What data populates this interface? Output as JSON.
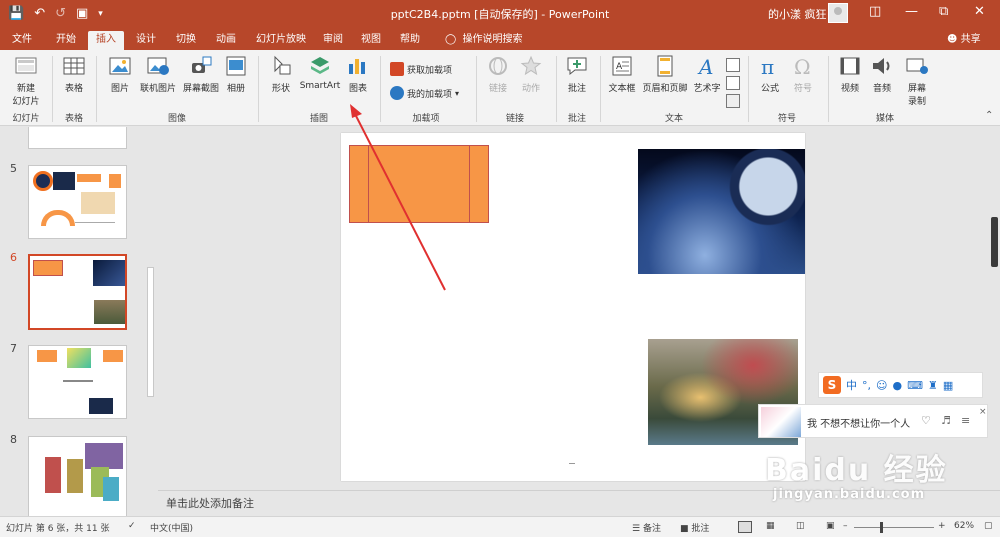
{
  "qat": {
    "save_icon": "save-icon",
    "undo_icon": "undo-icon",
    "redo_icon": "redo-icon",
    "present_icon": "present-icon",
    "more_icon": "chevron-down-icon"
  },
  "window": {
    "title": "pptC2B4.pptm [自动保存的] - PowerPoint",
    "user": "的小漾 疯狂"
  },
  "tabs": [
    "文件",
    "开始",
    "插入",
    "设计",
    "切换",
    "动画",
    "幻灯片放映",
    "审阅",
    "视图",
    "帮助"
  ],
  "active_tab": "插入",
  "tell_me": "操作说明搜索",
  "share": "共享",
  "ribbon": {
    "new_slide": "新建\n幻灯片",
    "table": "表格",
    "picture": "图片",
    "online_picture": "联机图片",
    "screenshot": "屏幕截图",
    "album": "相册",
    "shapes": "形状",
    "smartart": "SmartArt",
    "chart": "图表",
    "get_addins": "获取加载项",
    "my_addins": "我的加载项",
    "link": "链接",
    "action": "动作",
    "comment": "批注",
    "textbox": "文本框",
    "header_footer": "页眉和页脚",
    "wordart": "艺术字",
    "equation": "公式",
    "symbol": "符号",
    "video": "视频",
    "audio": "音频",
    "screen_record": "屏幕\n录制",
    "groups": {
      "slides": "幻灯片",
      "tables": "表格",
      "images": "图像",
      "illustrations": "插图",
      "addins": "加载项",
      "links": "链接",
      "comments": "批注",
      "text": "文本",
      "symbols": "符号",
      "media": "媒体"
    }
  },
  "thumbnails": {
    "n5": "5",
    "n6": "6",
    "n7": "7",
    "n8": "8"
  },
  "notes_placeholder": "单击此处添加备注",
  "status": {
    "slide_info": "幻灯片 第 6 张，共 11 张",
    "language": "中文(中国)",
    "notes": "备注",
    "comments": "批注",
    "zoom": "62%"
  },
  "ime": {
    "logo": "S",
    "mode": "中"
  },
  "music": {
    "song": "我 不想不想让你一个人"
  },
  "watermark": {
    "brand": "Baidu 经验",
    "url": "jingyan.baidu.com"
  },
  "colors": {
    "accent": "#b7472a",
    "shape_fill": "#f79646",
    "shape_border": "#c0504d"
  }
}
